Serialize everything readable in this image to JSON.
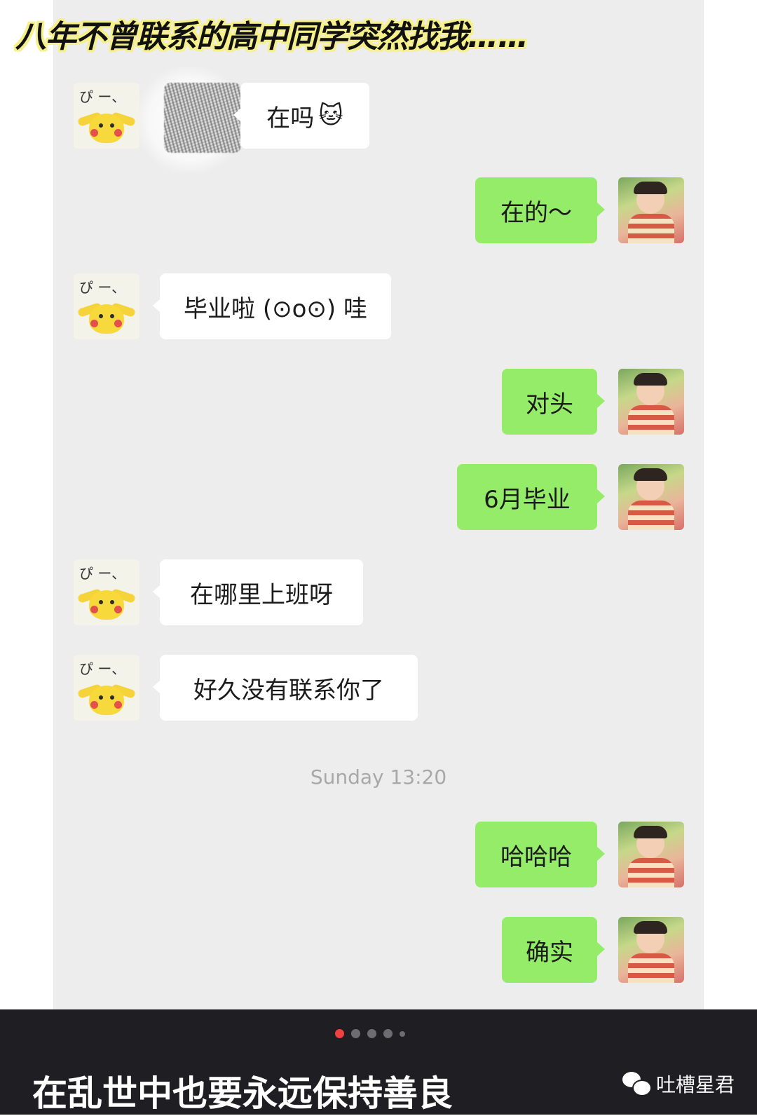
{
  "header": {
    "title": "八年不曾联系的高中同学突然找我……"
  },
  "messages": [
    {
      "side": "left",
      "text": "在吗",
      "icon": "doge-cat-emoji"
    },
    {
      "side": "right",
      "text": "在的～"
    },
    {
      "side": "left",
      "text": "毕业啦 (⊙o⊙) 哇"
    },
    {
      "side": "right",
      "text": "对头"
    },
    {
      "side": "right",
      "text": "6月毕业"
    },
    {
      "side": "left",
      "text": "在哪里上班呀"
    },
    {
      "side": "left",
      "text": "好久没有联系你了"
    },
    {
      "side": "right",
      "text": "哈哈哈"
    },
    {
      "side": "right",
      "text": "确实"
    }
  ],
  "timestamp": "Sunday 13:20",
  "avatar_left": {
    "doodle_text": "ぴ ー、",
    "icon": "pikachu-avatar"
  },
  "avatar_right": {
    "icon": "child-photo-avatar"
  },
  "pagination": {
    "total": 5,
    "active": 1
  },
  "footer": {
    "caption": "在乱世中也要永远保持善良",
    "account_name": "吐槽星君",
    "account_icon": "wechat-icon"
  },
  "colors": {
    "chat_background": "#ededed",
    "bubble_sent": "#95ec69",
    "bubble_received": "#ffffff",
    "bottom_bar": "#1e1e23",
    "active_dot": "#f04040",
    "title_highlight": "#f6f08a"
  }
}
